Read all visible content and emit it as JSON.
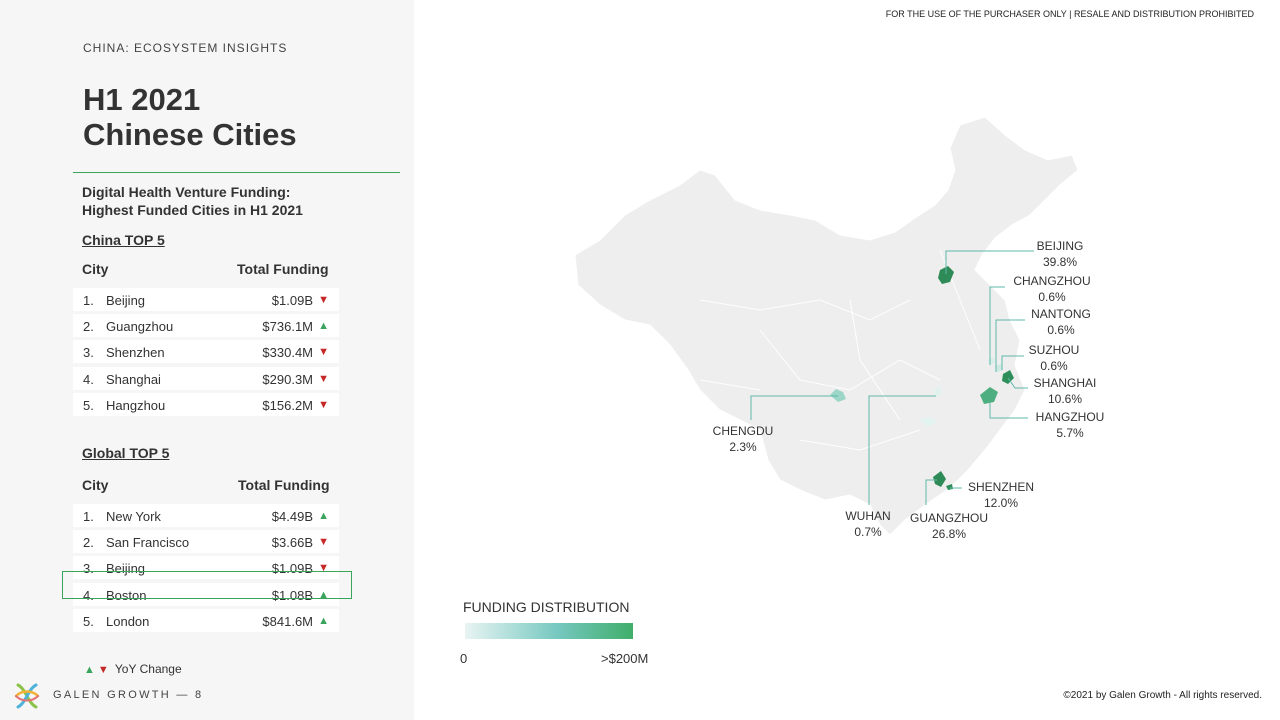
{
  "header": {
    "eyebrow": "CHINA: ECOSYSTEM INSIGHTS",
    "title_line1": "H1 2021",
    "title_line2": "Chinese Cities",
    "subtitle_line1": "Digital Health Venture Funding:",
    "subtitle_line2": "Highest Funded Cities in H1 2021",
    "disclaimer": "FOR THE USE OF THE PURCHASER ONLY | RESALE AND DISTRIBUTION PROHIBITED"
  },
  "china_top5": {
    "heading": "China TOP 5",
    "col_city": "City",
    "col_funding": "Total Funding",
    "rows": [
      {
        "rank": "1.",
        "city": "Beijing",
        "funding": "$1.09B",
        "trend": "down"
      },
      {
        "rank": "2.",
        "city": "Guangzhou",
        "funding": "$736.1M",
        "trend": "up"
      },
      {
        "rank": "3.",
        "city": "Shenzhen",
        "funding": "$330.4M",
        "trend": "down"
      },
      {
        "rank": "4.",
        "city": "Shanghai",
        "funding": "$290.3M",
        "trend": "down"
      },
      {
        "rank": "5.",
        "city": "Hangzhou",
        "funding": "$156.2M",
        "trend": "down"
      }
    ]
  },
  "global_top5": {
    "heading": "Global TOP 5",
    "col_city": "City",
    "col_funding": "Total Funding",
    "rows": [
      {
        "rank": "1.",
        "city": "New York",
        "funding": "$4.49B",
        "trend": "up"
      },
      {
        "rank": "2.",
        "city": "San Francisco",
        "funding": "$3.66B",
        "trend": "down"
      },
      {
        "rank": "3.",
        "city": "Beijing",
        "funding": "$1.09B",
        "trend": "down"
      },
      {
        "rank": "4.",
        "city": "Boston",
        "funding": "$1.08B",
        "trend": "up"
      },
      {
        "rank": "5.",
        "city": "London",
        "funding": "$841.6M",
        "trend": "up"
      }
    ]
  },
  "yoy_legend": "YoY Change",
  "footer": {
    "brand": "GALEN GROWTH  —  8",
    "copyright": "©2021 by Galen Growth  - All rights reserved."
  },
  "map": {
    "cities": [
      {
        "name": "BEIJING",
        "share": "39.8%"
      },
      {
        "name": "CHANGZHOU",
        "share": "0.6%"
      },
      {
        "name": "NANTONG",
        "share": "0.6%"
      },
      {
        "name": "SUZHOU",
        "share": "0.6%"
      },
      {
        "name": "SHANGHAI",
        "share": "10.6%"
      },
      {
        "name": "HANGZHOU",
        "share": "5.7%"
      },
      {
        "name": "CHENGDU",
        "share": "2.3%"
      },
      {
        "name": "SHENZHEN",
        "share": "12.0%"
      },
      {
        "name": "WUHAN",
        "share": "0.7%"
      },
      {
        "name": "GUANGZHOU",
        "share": "26.8%"
      }
    ],
    "legend": {
      "title": "FUNDING DISTRIBUTION",
      "min_label": "0",
      "max_label": ">$200M"
    }
  },
  "colors": {
    "accent_green": "#3aa45c",
    "down_red": "#c62828",
    "map_land": "#eeeeee"
  }
}
